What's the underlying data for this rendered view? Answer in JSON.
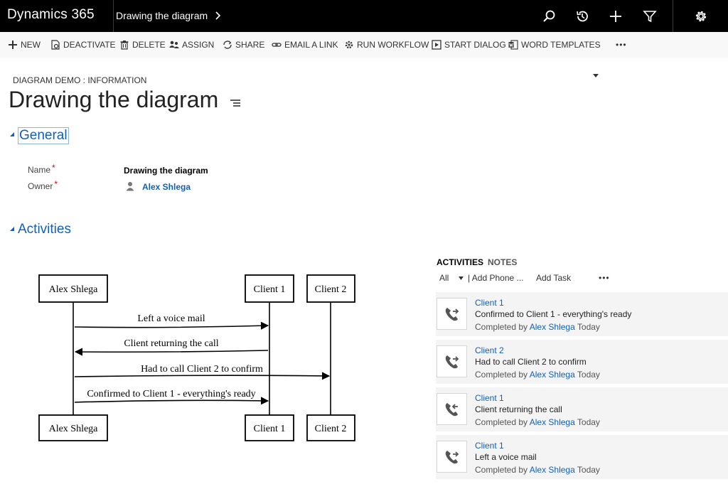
{
  "topbar": {
    "brand": "Dynamics 365",
    "breadcrumb": "Drawing the diagram"
  },
  "commands": [
    {
      "key": "new",
      "label": "NEW",
      "icon": "plus-icon"
    },
    {
      "key": "deactivate",
      "label": "DEACTIVATE",
      "icon": "deactivate-icon"
    },
    {
      "key": "delete",
      "label": "DELETE",
      "icon": "trash-icon"
    },
    {
      "key": "assign",
      "label": "ASSIGN",
      "icon": "assign-icon"
    },
    {
      "key": "share",
      "label": "SHARE",
      "icon": "share-icon"
    },
    {
      "key": "email",
      "label": "EMAIL A LINK",
      "icon": "link-icon"
    },
    {
      "key": "workflow",
      "label": "RUN WORKFLOW",
      "icon": "workflow-icon"
    },
    {
      "key": "dialog",
      "label": "START DIALOG",
      "icon": "dialog-icon"
    },
    {
      "key": "word",
      "label": "WORD TEMPLATES",
      "icon": "word-icon"
    }
  ],
  "header": {
    "entity_label": "DIAGRAM DEMO : INFORMATION",
    "title": "Drawing the diagram"
  },
  "general": {
    "section_title": "General",
    "name_label": "Name",
    "name_value": "Drawing the diagram",
    "owner_label": "Owner",
    "owner_value": "Alex Shlega",
    "required_mark": "*"
  },
  "activities_section": {
    "section_title": "Activities"
  },
  "diagram": {
    "participants_top": [
      "Alex Shlega",
      "Client 1",
      "Client 2"
    ],
    "participants_bottom": [
      "Alex Shlega",
      "Client 1",
      "Client 2"
    ],
    "messages": [
      "Left a voice mail",
      "Client returning the call",
      "Had to call Client 2 to confirm",
      "Confirmed to Client 1 - everything's ready"
    ]
  },
  "activities_panel": {
    "tab_activities": "ACTIVITIES",
    "tab_notes": "NOTES",
    "filter_all": "All",
    "add_phone": "| Add Phone ...",
    "add_task": "Add Task",
    "more": "•••",
    "items": [
      {
        "who": "Client 1",
        "desc": "Confirmed to Client 1 - everything's ready",
        "completed_by": "Completed by",
        "user": "Alex Shlega",
        "when": "Today",
        "direction": "outgoing"
      },
      {
        "who": "Client 2",
        "desc": "Had to call Client 2 to confirm",
        "completed_by": "Completed by",
        "user": "Alex Shlega",
        "when": "Today",
        "direction": "outgoing"
      },
      {
        "who": "Client 1",
        "desc": "Client returning the call",
        "completed_by": "Completed by",
        "user": "Alex Shlega",
        "when": "Today",
        "direction": "incoming"
      },
      {
        "who": "Client 1",
        "desc": "Left a voice mail",
        "completed_by": "Completed by",
        "user": "Alex Shlega",
        "when": "Today",
        "direction": "outgoing"
      }
    ]
  },
  "cmd_more": "•••",
  "colors": {
    "accent": "#1160b7",
    "topbar": "#000000"
  }
}
